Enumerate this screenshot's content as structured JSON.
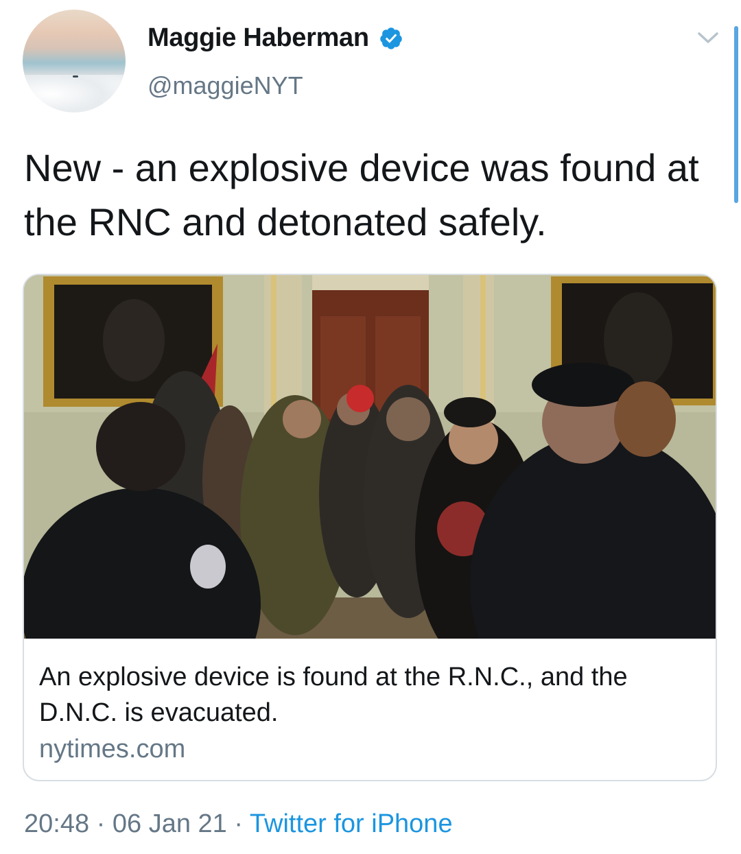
{
  "author": {
    "name": "Maggie Haberman",
    "handle": "@maggieNYT",
    "verified": true
  },
  "tweet": {
    "text": "New - an explosive device was found at the RNC and detonated safely."
  },
  "card": {
    "image": "photo of a crowd inside the Capitol, police officers in the foreground",
    "title": "An explosive device is found at the R.N.C., and the D.N.C. is evacuated.",
    "domain": "nytimes.com"
  },
  "meta": {
    "time": "20:48",
    "separator": "·",
    "date": "06 Jan 21",
    "source": "Twitter for iPhone"
  },
  "icons": {
    "verified": "verified-badge-icon",
    "more": "chevron-down-icon"
  },
  "colors": {
    "accent": "#1b95e0",
    "secondary_text": "#657786",
    "primary_text": "#14171a"
  }
}
